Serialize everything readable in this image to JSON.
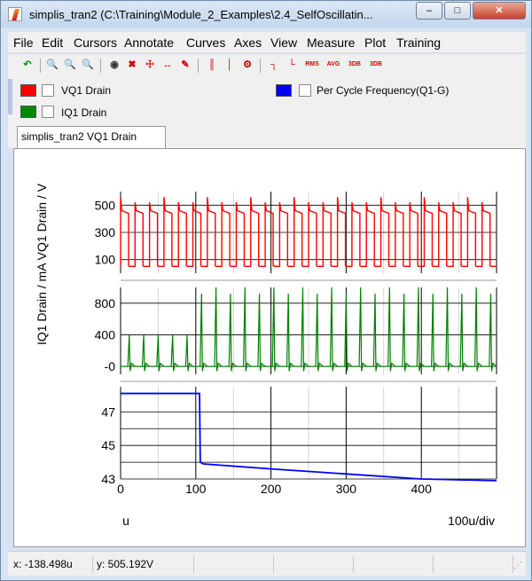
{
  "window": {
    "title": "simplis_tran2 (C:\\Training\\Module_2_Examples\\2.4_SelfOscillatin...",
    "minimize_label": "–",
    "maximize_label": "□",
    "close_label": "✕"
  },
  "menu": [
    "File",
    "Edit",
    "Cursors",
    "Annotate",
    "Curves",
    "Axes",
    "View",
    "Measure",
    "Plot",
    "Training"
  ],
  "toolbar": {
    "buttons": [
      "undo-icon",
      "zoom-in-icon",
      "zoom-out-icon",
      "zoom-fit-icon",
      "eye-icon",
      "delete-curve-icon",
      "add-curve-icon",
      "move-curve-icon",
      "edit-curve-icon",
      "cursor-pair-icon",
      "cursor-single-icon",
      "cursor-settings-icon",
      "step-measure-icon",
      "falling-edge-icon",
      "rms-icon",
      "avg-icon",
      "3db-high-icon",
      "3db-low-icon"
    ],
    "text_labels": {
      "rms": "RMS",
      "avg": "AVG",
      "db1": "3DB",
      "db2": "3DB"
    }
  },
  "legend": {
    "entries": [
      {
        "label": "VQ1 Drain",
        "color": "#ff0000"
      },
      {
        "label": "IQ1 Drain",
        "color": "#008000"
      },
      {
        "label": "Per Cycle Frequency(Q1-G)",
        "color": "#0000ff"
      }
    ]
  },
  "tab": {
    "label": "simplis_tran2 VQ1 Drain"
  },
  "plot": {
    "ylabel_combined": "IQ1 Drain / mA  VQ1 Drain / V",
    "x_unit": "u",
    "x_div_label": "100u/div",
    "panel1_ticks": [
      "500",
      "300",
      "100"
    ],
    "panel2_ticks": [
      "800",
      "400",
      "-0"
    ],
    "panel3_ticks": [
      "47",
      "45",
      "43"
    ],
    "x_ticks": [
      "0",
      "100",
      "200",
      "300",
      "400"
    ]
  },
  "chart_data": [
    {
      "type": "line",
      "series": [
        {
          "name": "VQ1 Drain",
          "color": "#ff0000"
        }
      ],
      "ylabel": "VQ1 Drain / V",
      "ylim": [
        0,
        600
      ],
      "x_range": [
        0,
        500
      ],
      "pulses": 26,
      "high_level": 440,
      "low_level": 50,
      "spike": 560
    },
    {
      "type": "line",
      "series": [
        {
          "name": "IQ1 Drain",
          "color": "#008000"
        }
      ],
      "ylabel": "IQ1 Drain / mA",
      "ylim": [
        -100,
        1000
      ],
      "x_range": [
        0,
        500
      ],
      "pulses": 26,
      "peak_early": 400,
      "peak_late": 1000
    },
    {
      "type": "line",
      "series": [
        {
          "name": "Per Cycle Frequency(Q1-G)",
          "color": "#0000ff"
        }
      ],
      "ylim": [
        43,
        48.5
      ],
      "x": [
        0,
        105,
        106,
        110,
        200,
        300,
        400,
        500
      ],
      "y": [
        48.1,
        48.1,
        44.0,
        43.9,
        43.6,
        43.3,
        43.0,
        42.9
      ]
    }
  ],
  "status": {
    "x": "x: -138.498u",
    "y": "y: 505.192V"
  }
}
